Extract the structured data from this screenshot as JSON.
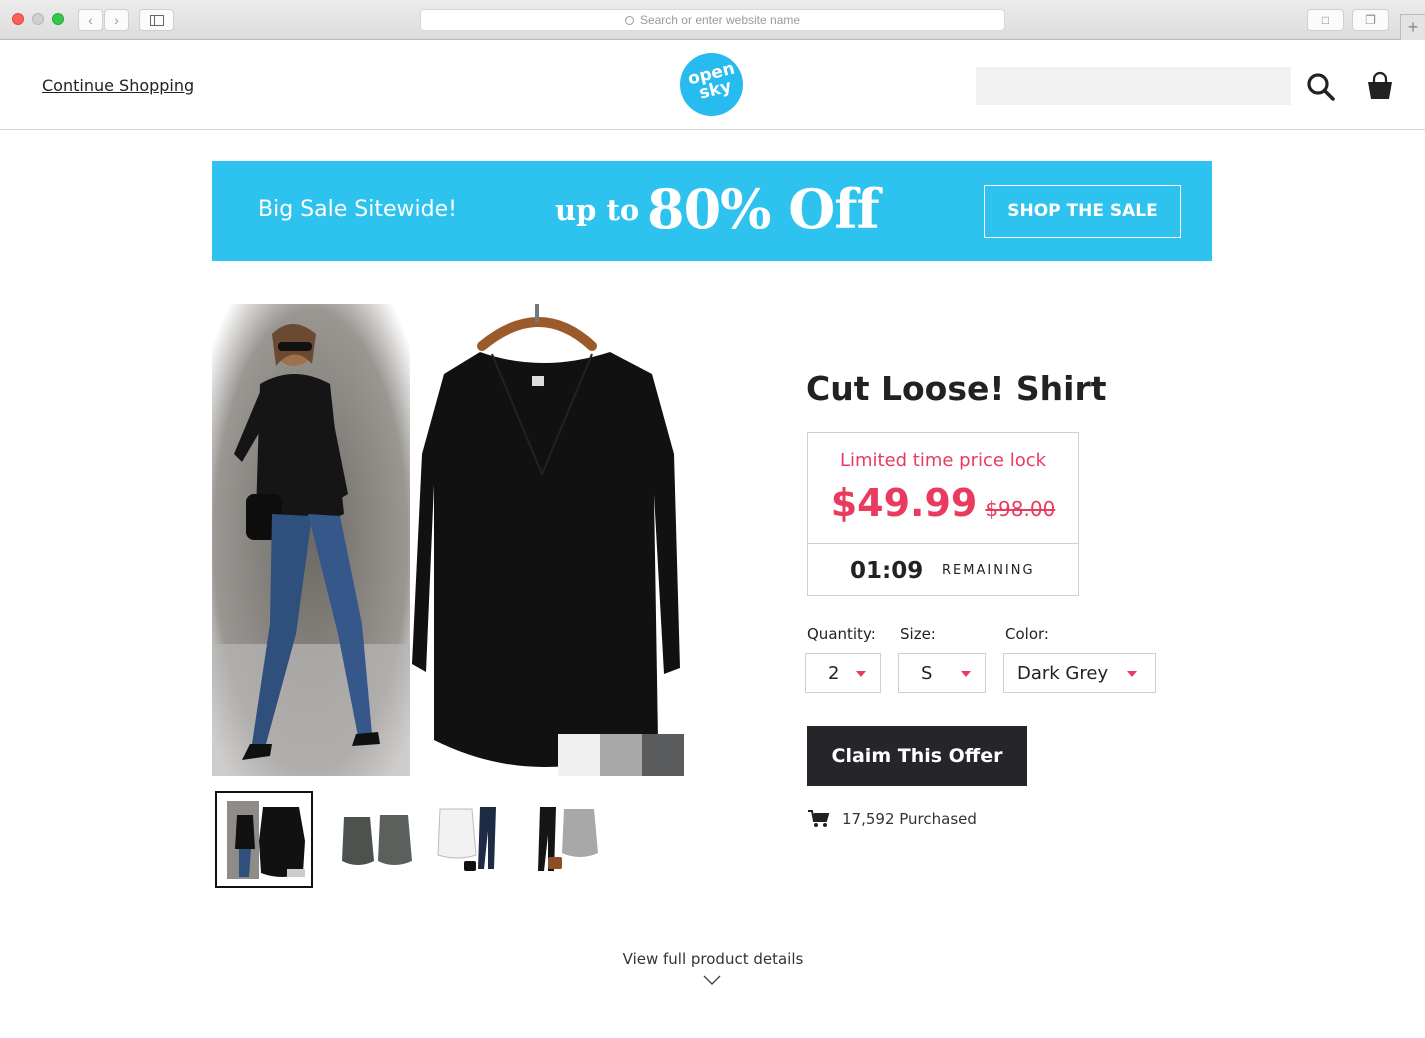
{
  "browser": {
    "address_placeholder": "Search or enter website name",
    "back_icon": "chevron-left-icon",
    "forward_icon": "chevron-right-icon",
    "new_tab_label": "+"
  },
  "header": {
    "continue_shopping": "Continue Shopping",
    "logo_line1": "open",
    "logo_line2": "sky",
    "search_placeholder": "",
    "brand_color": "#27bbef"
  },
  "banner": {
    "left_text": "Big Sale Sitewide!",
    "up_to": "up to",
    "discount": "80% Off",
    "button_label": "SHOP THE SALE",
    "background": "#2ec2ef"
  },
  "product": {
    "title": "Cut Loose! Shirt",
    "price_lock_label": "Limited time price lock",
    "price": "$49.99",
    "original_price": "$98.00",
    "timer": "01:09",
    "remaining_label": "REMAINING",
    "accent_color": "#e83b5f",
    "options": {
      "quantity_label": "Quantity:",
      "quantity_value": "2",
      "size_label": "Size:",
      "size_value": "S",
      "color_label": "Color:",
      "color_value": "Dark Grey"
    },
    "claim_button": "Claim This Offer",
    "purchased": "17,592 Purchased",
    "thumbnails": [
      {
        "name": "model-and-black-shirt",
        "selected": true
      },
      {
        "name": "two-grey-shirts",
        "selected": false
      },
      {
        "name": "white-shirt-outfit",
        "selected": false
      },
      {
        "name": "grey-shirt-outfit",
        "selected": false
      }
    ]
  },
  "footer": {
    "view_details": "View full product details"
  }
}
